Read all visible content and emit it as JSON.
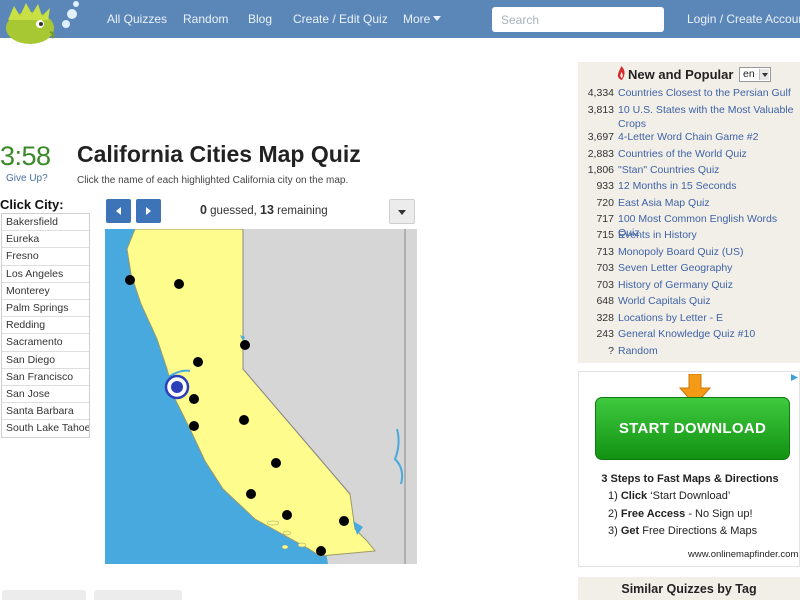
{
  "nav": {
    "links": [
      "All Quizzes",
      "Random",
      "Blog",
      "Create / Edit Quiz",
      "More",
      "Login / Create Account"
    ],
    "search_placeholder": "Search"
  },
  "quiz": {
    "timer": "3:58",
    "give_up": "Give Up?",
    "title": "California Cities Map Quiz",
    "subtitle": "Click the name of each highlighted California city on the map.",
    "click_city_label": "Click City:",
    "cities": [
      "Bakersfield",
      "Eureka",
      "Fresno",
      "Los Angeles",
      "Monterey",
      "Palm Springs",
      "Redding",
      "Sacramento",
      "San Diego",
      "San Francisco",
      "San Jose",
      "Santa Barbara",
      "South Lake Tahoe"
    ],
    "guessed": "0",
    "guessed_text": " guessed, ",
    "remaining": "13",
    "remaining_text": " remaining"
  },
  "sidebar": {
    "new_popular_title": "New and Popular",
    "language": "en",
    "items": [
      {
        "count": "4,334",
        "title": "Countries Closest to the Persian Gulf"
      },
      {
        "count": "3,813",
        "title": "10 U.S. States with the Most Valuable Crops"
      },
      {
        "count": "3,697",
        "title": "4-Letter Word Chain Game #2"
      },
      {
        "count": "2,883",
        "title": "Countries of the World Quiz"
      },
      {
        "count": "1,806",
        "title": "\"Stan\" Countries Quiz"
      },
      {
        "count": "933",
        "title": "12 Months in 15 Seconds"
      },
      {
        "count": "720",
        "title": "East Asia Map Quiz"
      },
      {
        "count": "717",
        "title": "100 Most Common English Words Quiz"
      },
      {
        "count": "715",
        "title": "Events in History"
      },
      {
        "count": "713",
        "title": "Monopoly Board Quiz (US)"
      },
      {
        "count": "703",
        "title": "Seven Letter Geography"
      },
      {
        "count": "703",
        "title": "History of Germany Quiz"
      },
      {
        "count": "648",
        "title": "World Capitals Quiz"
      },
      {
        "count": "328",
        "title": "Locations by Letter - E"
      },
      {
        "count": "243",
        "title": "General Knowledge Quiz #10"
      },
      {
        "count": "?",
        "title": "Random"
      }
    ],
    "ad": {
      "button": "START DOWNLOAD",
      "heading": "3 Steps to Fast Maps & Directions",
      "step1_bold": "Click",
      "step1_rest": " ‘Start Download’",
      "step2_bold": "Free Access",
      "step2_rest": " - No Sign up!",
      "step3_bold": "Get",
      "step3_rest": " Free Directions & Maps",
      "url": "www.onlinemapfinder.com"
    },
    "similar_title": "Similar Quizzes by Tag"
  },
  "colors": {
    "nav_bg": "#5b87b8",
    "timer": "#3a8a2a",
    "link": "#3f63a5",
    "state_fill": "#fdfc8c",
    "ocean": "#48a9de",
    "ad_green": "#1fae1f"
  }
}
